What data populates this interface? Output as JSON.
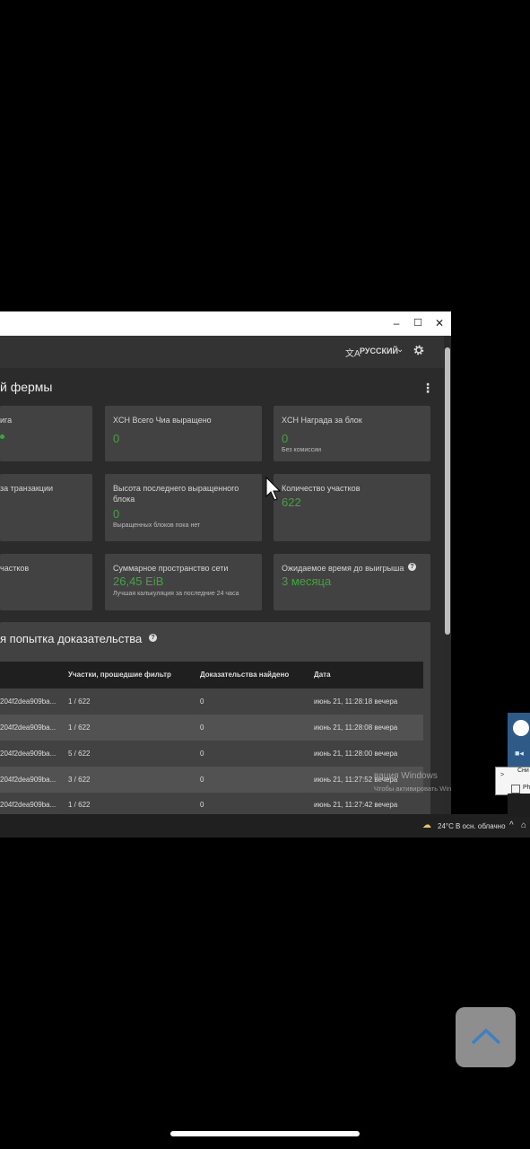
{
  "window": {
    "controls": {
      "minimize": "–",
      "maximize": "☐",
      "close": "✕"
    },
    "language_label": "РУССКИЙ",
    "page_title": "й фермы",
    "cards": [
      {
        "title": "ига",
        "value": "",
        "sub": ""
      },
      {
        "title": "XCH Всего Чиа выращено",
        "value": "0",
        "sub": ""
      },
      {
        "title": "XCH Награда за блок",
        "value": "0",
        "sub": "Без комиссии"
      },
      {
        "title": "за транзакции",
        "value": "",
        "sub": ""
      },
      {
        "title": "Высота последнего выращенного блока",
        "value": "0",
        "sub": "Выращенных блоков пока нет"
      },
      {
        "title": "Количество участков",
        "value": "622",
        "sub": ""
      },
      {
        "title": "частков",
        "value": "",
        "sub": ""
      },
      {
        "title": "Суммарное пространство сети",
        "value": "26,45 EiB",
        "sub": "Лучшая калькуляция за последние 24 часа"
      },
      {
        "title": "Ожидаемое время до выигрыша",
        "value": "3 месяца",
        "sub": ""
      }
    ],
    "attempts": {
      "title": "я попытка доказательства",
      "columns": [
        "Участки, прошедшие фильтр",
        "Доказательства найдено",
        "Дата"
      ],
      "rows": [
        {
          "challenge": "204f2dea909ba...",
          "plots": "1 / 622",
          "proofs": "0",
          "date": "июнь 21, 11:28:18 вечера"
        },
        {
          "challenge": "204f2dea909ba...",
          "plots": "1 / 622",
          "proofs": "0",
          "date": "июнь 21, 11:28:08 вечера"
        },
        {
          "challenge": "204f2dea909ba...",
          "plots": "5 / 622",
          "proofs": "0",
          "date": "июнь 21, 11:28:00 вечера"
        },
        {
          "challenge": "204f2dea909ba...",
          "plots": "3 / 622",
          "proofs": "0",
          "date": "июнь 21, 11:27:52 вечера"
        },
        {
          "challenge": "204f2dea909ba...",
          "plots": "1 / 622",
          "proofs": "0",
          "date": "июнь 21, 11:27:42 вечера"
        }
      ]
    }
  },
  "watermark": {
    "line1": "вация Windows",
    "line2": "Чтобы активировать Windows, перейдите"
  },
  "taskbar": {
    "temp": "24°C",
    "weather": "В осн. облачно"
  },
  "tray_popup": {
    "item1": "Сни",
    "item2": "Ph"
  },
  "colors": {
    "accent_green": "#3aaa35",
    "card_bg": "#424242",
    "page_bg": "#2b2b2b"
  }
}
